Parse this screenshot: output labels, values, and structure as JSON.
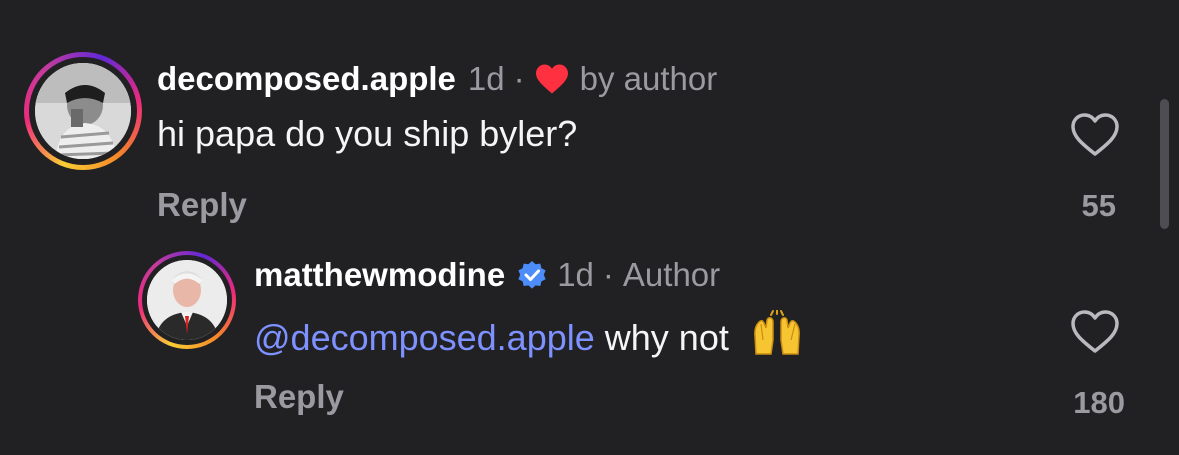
{
  "comments": [
    {
      "username": "decomposed.apple",
      "time": "1d",
      "liked_by": "by author",
      "text": "hi papa do you ship byler?",
      "reply_label": "Reply",
      "likes": "55"
    },
    {
      "username": "matthewmodine",
      "verified": true,
      "time": "1d",
      "role": "Author",
      "mention": "@decomposed.apple",
      "text": " why not",
      "emoji": "raising-hands",
      "reply_label": "Reply",
      "likes": "180"
    }
  ],
  "separator": "·",
  "colors": {
    "background": "#212124",
    "mention": "#7d91ff",
    "heart_red": "#ff3040",
    "verified_blue": "#4c8dfa",
    "muted_text": "#9a9aa0"
  }
}
